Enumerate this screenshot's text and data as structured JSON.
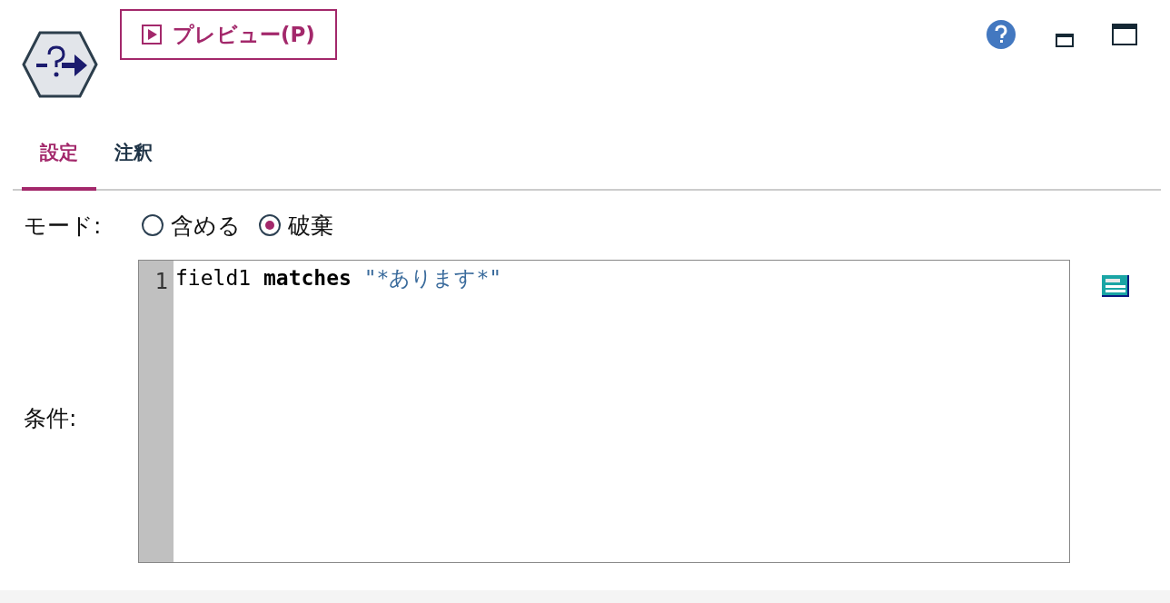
{
  "toolbar": {
    "preview_button": "プレビュー(P)"
  },
  "tabs": [
    {
      "label": "設定",
      "selected": true
    },
    {
      "label": "注釈",
      "selected": false
    }
  ],
  "mode": {
    "label": "モード:",
    "options": [
      {
        "label": "含める",
        "selected": false
      },
      {
        "label": "破棄",
        "selected": true
      }
    ]
  },
  "condition": {
    "label": "条件:",
    "lines": [
      {
        "number": "1",
        "tokens": [
          {
            "kind": "plain",
            "text": "field1 "
          },
          {
            "kind": "keyword",
            "text": "matches"
          },
          {
            "kind": "string",
            "text": " \"*あります*\""
          }
        ]
      }
    ]
  }
}
